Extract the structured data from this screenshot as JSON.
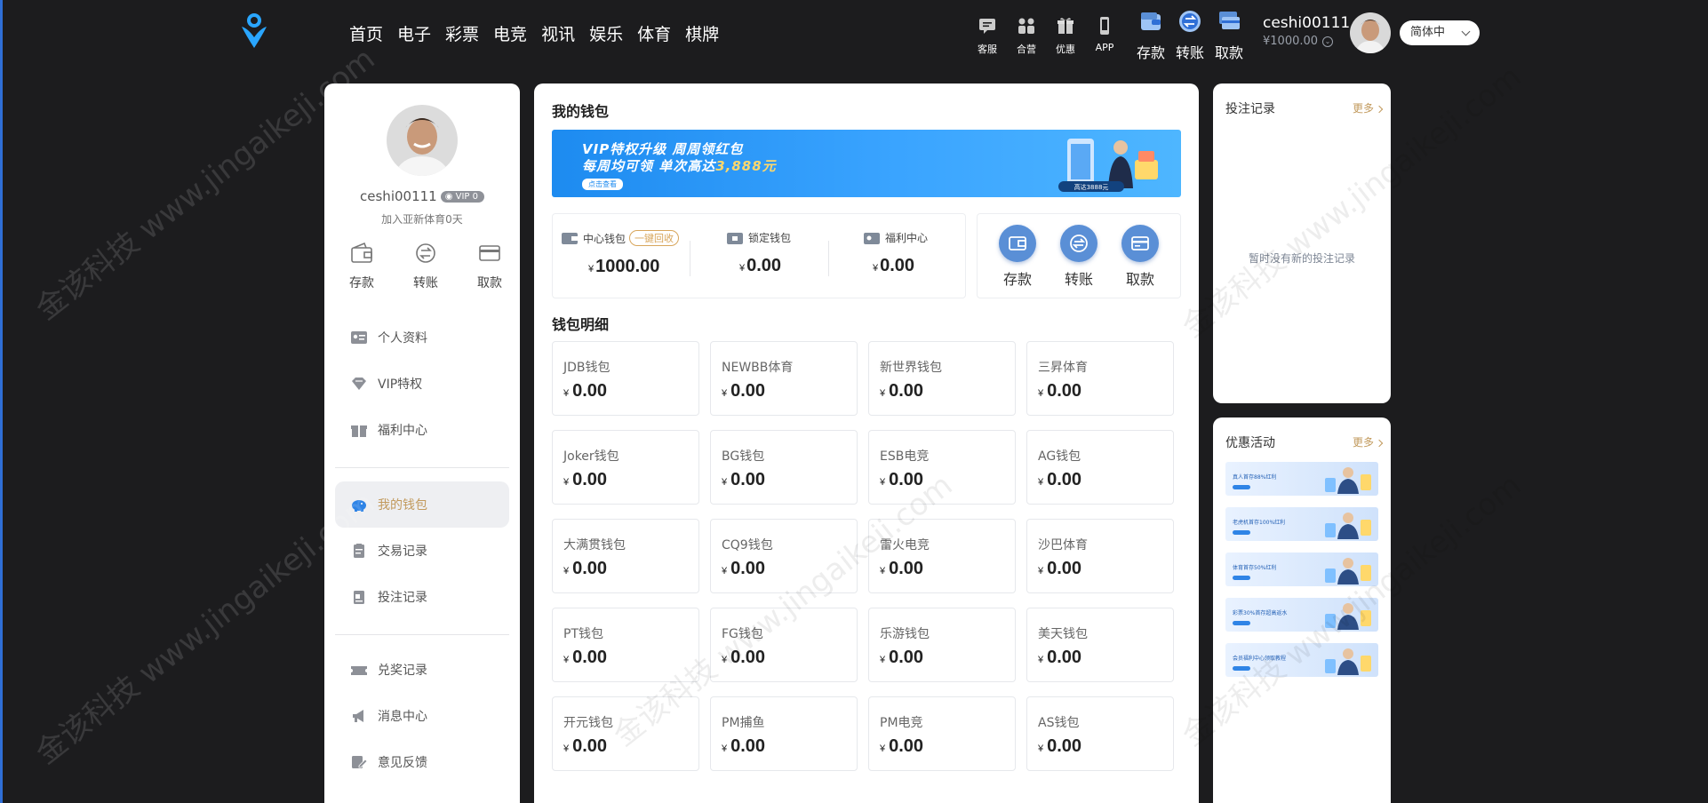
{
  "header": {
    "nav": [
      "首页",
      "电子",
      "彩票",
      "电竞",
      "视讯",
      "娱乐",
      "体育",
      "棋牌"
    ],
    "tools": [
      {
        "label": "客服",
        "icon": "chat-icon"
      },
      {
        "label": "合营",
        "icon": "partner-icon"
      },
      {
        "label": "优惠",
        "icon": "gift-icon"
      },
      {
        "label": "APP",
        "icon": "phone-icon"
      }
    ],
    "money_tools": [
      {
        "label": "存款",
        "icon": "deposit-icon"
      },
      {
        "label": "转账",
        "icon": "transfer-icon"
      },
      {
        "label": "取款",
        "icon": "withdraw-icon"
      }
    ],
    "username": "ceshi00111",
    "balance": "¥1000.00",
    "language": "简体中"
  },
  "sidebar": {
    "username": "ceshi00111",
    "vip": "VIP 0",
    "joined": "加入亚新体育0天",
    "actions": [
      {
        "label": "存款",
        "icon": "wallet-icon"
      },
      {
        "label": "转账",
        "icon": "transfer-icon"
      },
      {
        "label": "取款",
        "icon": "card-icon"
      }
    ],
    "menu": [
      {
        "label": "个人资料",
        "icon": "id-card-icon"
      },
      {
        "label": "VIP特权",
        "icon": "diamond-icon"
      },
      {
        "label": "福利中心",
        "icon": "gift-icon"
      },
      {
        "label": "我的钱包",
        "icon": "piggy-bank-icon",
        "active": true
      },
      {
        "label": "交易记录",
        "icon": "clipboard-icon"
      },
      {
        "label": "投注记录",
        "icon": "document-icon"
      },
      {
        "label": "兑奖记录",
        "icon": "ticket-icon"
      },
      {
        "label": "消息中心",
        "icon": "megaphone-icon"
      },
      {
        "label": "意见反馈",
        "icon": "edit-icon"
      }
    ]
  },
  "main": {
    "title": "我的钱包",
    "banner": {
      "line1": "VIP特权升级  周周领红包",
      "line2_pre": "每周均可领  单次高达",
      "line2_hl": "3,888元",
      "button": "点击查看",
      "art_text": "高达3888元"
    },
    "wallets": [
      {
        "label": "中心钱包",
        "amount": "1000.00",
        "recall": "一键回收",
        "icon": "wallet-icon"
      },
      {
        "label": "锁定钱包",
        "amount": "0.00",
        "icon": "lock-wallet-icon"
      },
      {
        "label": "福利中心",
        "amount": "0.00",
        "icon": "gift-wallet-icon"
      }
    ],
    "yen": "¥",
    "ops": [
      {
        "label": "存款",
        "icon": "deposit-icon"
      },
      {
        "label": "转账",
        "icon": "transfer-icon"
      },
      {
        "label": "取款",
        "icon": "withdraw-icon"
      }
    ],
    "detail_title": "钱包明细",
    "details": [
      {
        "name": "JDB钱包",
        "amount": "0.00"
      },
      {
        "name": "NEWBB体育",
        "amount": "0.00"
      },
      {
        "name": "新世界钱包",
        "amount": "0.00"
      },
      {
        "name": "三昇体育",
        "amount": "0.00"
      },
      {
        "name": "Joker钱包",
        "amount": "0.00"
      },
      {
        "name": "BG钱包",
        "amount": "0.00"
      },
      {
        "name": "ESB电竞",
        "amount": "0.00"
      },
      {
        "name": "AG钱包",
        "amount": "0.00"
      },
      {
        "name": "大满贯钱包",
        "amount": "0.00"
      },
      {
        "name": "CQ9钱包",
        "amount": "0.00"
      },
      {
        "name": "雷火电竞",
        "amount": "0.00"
      },
      {
        "name": "沙巴体育",
        "amount": "0.00"
      },
      {
        "name": "PT钱包",
        "amount": "0.00"
      },
      {
        "name": "FG钱包",
        "amount": "0.00"
      },
      {
        "name": "乐游钱包",
        "amount": "0.00"
      },
      {
        "name": "美天钱包",
        "amount": "0.00"
      },
      {
        "name": "开元钱包",
        "amount": "0.00"
      },
      {
        "name": "PM捕鱼",
        "amount": "0.00"
      },
      {
        "name": "PM电竞",
        "amount": "0.00"
      },
      {
        "name": "AS钱包",
        "amount": "0.00"
      }
    ]
  },
  "right": {
    "bets_title": "投注记录",
    "bets_more": "更多",
    "bets_empty": "暂时没有新的投注记录",
    "promo_title": "优惠活动",
    "promo_more": "更多",
    "promos": [
      {
        "text": "真人首存88%红利"
      },
      {
        "text": "老虎机首存100%红利"
      },
      {
        "text": "体育首存50%红利"
      },
      {
        "text": "彩票30%首存超高返水"
      },
      {
        "text": "会员福利中心领取教程"
      }
    ]
  },
  "watermark": [
    "www.jingaikeji.com",
    "金该科技"
  ],
  "colors": {
    "accent": "#c29a5d",
    "primary": "#2f84e6",
    "op_circle": "#5a8fd6",
    "bg": "#1c1c1e"
  }
}
